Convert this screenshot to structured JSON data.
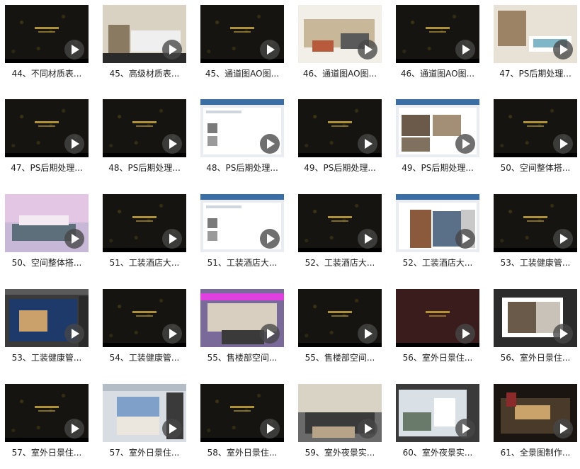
{
  "videos": [
    {
      "title": "44、不同材质表...",
      "thumb": "dark"
    },
    {
      "title": "45、高级材质表...",
      "thumb": "bathroom"
    },
    {
      "title": "45、通道图AO图...",
      "thumb": "dark"
    },
    {
      "title": "46、通道图AO图...",
      "thumb": "livingroom"
    },
    {
      "title": "46、通道图AO图...",
      "thumb": "dark"
    },
    {
      "title": "47、PS后期处理...",
      "thumb": "bathtub"
    },
    {
      "title": "47、PS后期处理...",
      "thumb": "dark"
    },
    {
      "title": "48、PS后期处理...",
      "thumb": "dark"
    },
    {
      "title": "48、PS后期处理...",
      "thumb": "browser"
    },
    {
      "title": "49、PS后期处理...",
      "thumb": "dark"
    },
    {
      "title": "49、PS后期处理...",
      "thumb": "browser-photos"
    },
    {
      "title": "50、空间整体搭...",
      "thumb": "dark"
    },
    {
      "title": "50、空间整体搭...",
      "thumb": "render-pink"
    },
    {
      "title": "51、工装酒店大...",
      "thumb": "dark"
    },
    {
      "title": "51、工装酒店大...",
      "thumb": "browser"
    },
    {
      "title": "52、工装酒店大...",
      "thumb": "dark"
    },
    {
      "title": "52、工装酒店大...",
      "thumb": "browser-street"
    },
    {
      "title": "53、工装健康管...",
      "thumb": "dark"
    },
    {
      "title": "53、工装健康管...",
      "thumb": "3dsmax"
    },
    {
      "title": "54、工装健康管...",
      "thumb": "dark"
    },
    {
      "title": "55、售楼部空间...",
      "thumb": "lobby"
    },
    {
      "title": "55、售楼部空间...",
      "thumb": "dark"
    },
    {
      "title": "56、室外日景住...",
      "thumb": "dark-red"
    },
    {
      "title": "56、室外日景住...",
      "thumb": "photoshop"
    },
    {
      "title": "57、室外日景住...",
      "thumb": "dark"
    },
    {
      "title": "57、室外日景住...",
      "thumb": "building"
    },
    {
      "title": "58、室外日景住...",
      "thumb": "dark"
    },
    {
      "title": "59、室外夜景实...",
      "thumb": "sofa"
    },
    {
      "title": "60、室外夜景实...",
      "thumb": "exterior"
    },
    {
      "title": "61、全景图制作...",
      "thumb": "dining"
    }
  ]
}
